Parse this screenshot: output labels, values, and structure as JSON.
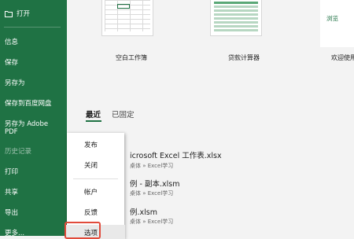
{
  "nav": {
    "open": "打开",
    "items": [
      "信息",
      "保存",
      "另存为",
      "保存到百度网盘",
      "另存为 Adobe PDF",
      "历史记录",
      "打印",
      "共享",
      "导出",
      "更多..."
    ]
  },
  "templates": [
    {
      "caption": "空白工作簿"
    },
    {
      "caption": "贷款计算器"
    },
    {
      "caption": "欢迎使用",
      "badge": "浏览"
    }
  ],
  "tabs": {
    "recent": "最近",
    "pinned": "已固定"
  },
  "files": [
    {
      "name": "icrosoft Excel 工作表.xlsx",
      "path": "桌体 » Excel学习"
    },
    {
      "name": "例 - 副本.xlsm",
      "path": "桌体 » Excel学习"
    },
    {
      "name": "例.xlsm",
      "path": "桌体 » Excel学习"
    }
  ],
  "popup": {
    "items": [
      "发布",
      "关闭",
      "帐户",
      "反馈",
      "选项"
    ]
  },
  "footer": {
    "dots": "·· ··"
  },
  "colors": {
    "brand": "#1f7244",
    "highlight_border": "#e14b3b"
  }
}
